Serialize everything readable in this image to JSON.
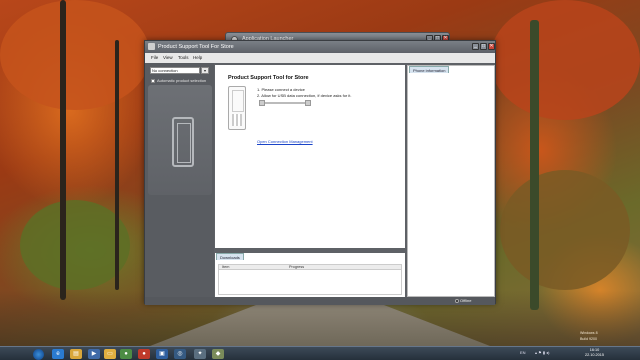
{
  "launcher": {
    "title": "Application Launcher"
  },
  "window": {
    "title": "Product Support Tool For Store",
    "controls": {
      "minimize": "_",
      "maximize": "□",
      "close": "✕"
    }
  },
  "menu": {
    "items": [
      "File",
      "View",
      "Tools",
      "Help"
    ]
  },
  "sidebar": {
    "connection_value": "No connection",
    "connection_arrow": "▾",
    "auto_select_label": "Automatic product selection"
  },
  "content": {
    "title": "Product Support Tool for Store",
    "step1": "1. Please connect a device",
    "step2": "2. Allow for USB data connection, if device asks for it.",
    "link": "Open Connection Management"
  },
  "phone_info": {
    "tab": "Phone information"
  },
  "downloads": {
    "tab": "Downloads",
    "columns": [
      "Item",
      "Progress"
    ]
  },
  "status": {
    "text": "Offline"
  },
  "taskbar": {
    "icons": [
      "ie-icon",
      "explorer-icon",
      "media-icon",
      "chrome-icon",
      "record-icon",
      "window-icon",
      "browser-icon",
      "tool-icon"
    ],
    "tray_lang": "EN",
    "clock_time": "16:10",
    "clock_date": "22.10.2015"
  },
  "desktop_text": {
    "line1": "Windows 8",
    "line2": "Build 9200"
  },
  "colors": {
    "accent": "#1a44c8",
    "window_bg": "#5e6166",
    "taskbar": "#25303b"
  }
}
